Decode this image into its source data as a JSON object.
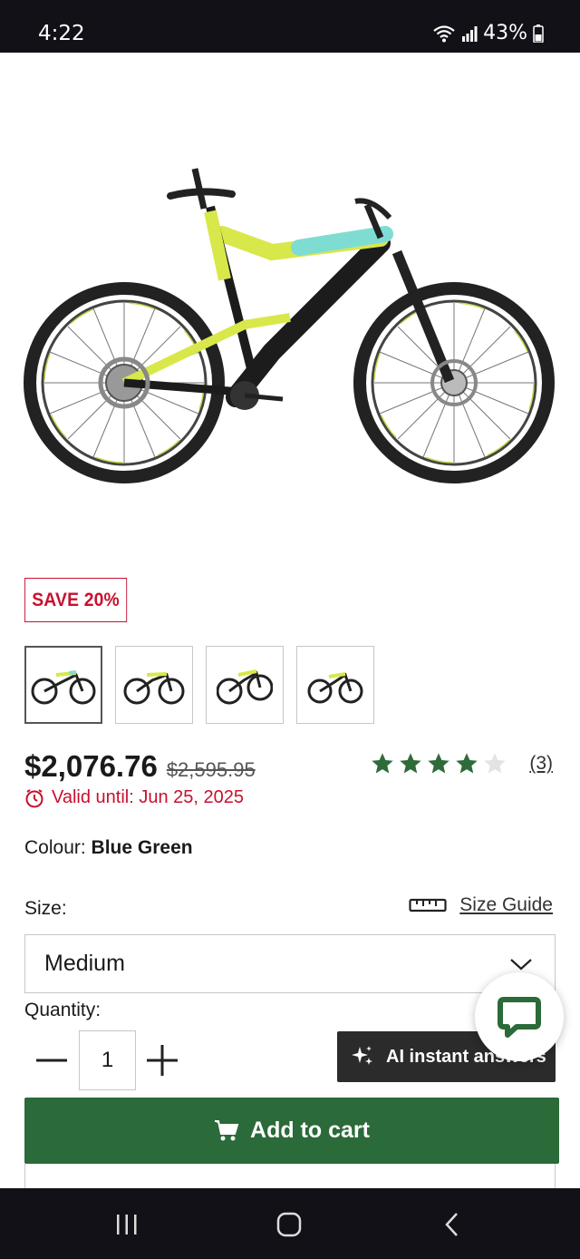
{
  "status_bar": {
    "time": "4:22",
    "battery": "43%"
  },
  "product": {
    "image_alt": "Full suspension mountain bike, blue-green frame",
    "save_badge": "SAVE 20%",
    "thumbnails": [
      {
        "name": "thumbnail-1",
        "selected": true
      },
      {
        "name": "thumbnail-2",
        "selected": false
      },
      {
        "name": "thumbnail-3",
        "selected": false
      },
      {
        "name": "thumbnail-4",
        "selected": false
      }
    ],
    "price_now": "$2,076.76",
    "price_was": "$2,595.95",
    "rating": {
      "stars": 4,
      "max": 5,
      "count_label": "(3)"
    },
    "valid_until": "Valid until: Jun 25, 2025",
    "colour_label": "Colour:",
    "colour_value": "Blue Green",
    "size_label": "Size:",
    "size_guide": "Size Guide",
    "size_selected": "Medium",
    "quantity_label": "Quantity:",
    "quantity_value": "1",
    "ai_button": "AI instant answers",
    "add_to_cart": "Add to cart"
  },
  "colors": {
    "accent_red": "#c8102e",
    "cart_green": "#2b6a39",
    "star_green": "#2e6b3a",
    "frame_yellow": "#d8e84a",
    "frame_teal": "#7fdcd3"
  }
}
